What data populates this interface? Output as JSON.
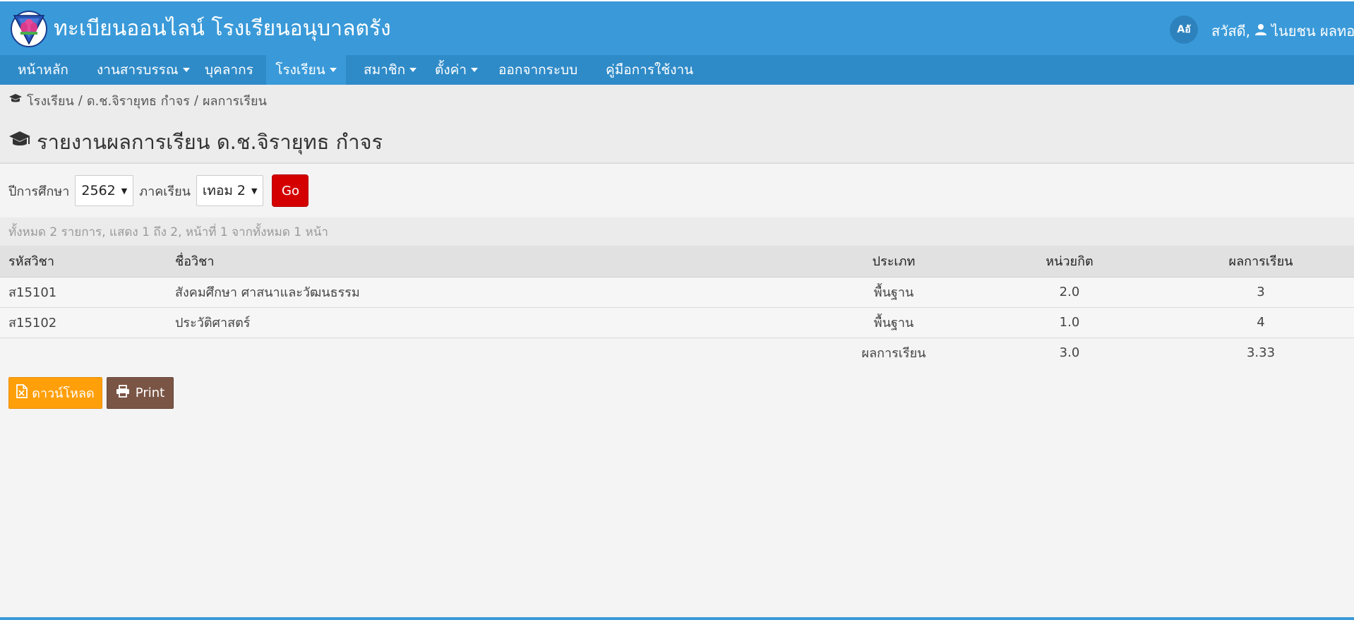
{
  "header": {
    "brand_title": "ทะเบียนออนไลน์ โรงเรียนอนุบาลตรัง",
    "lang_button": "Aอั",
    "greeting": "สวัสดี,",
    "user_name": "ไนยชน ผลทอง"
  },
  "nav": {
    "items": [
      {
        "label": "หน้าหลัก"
      },
      {
        "label": "งานสารบรรณ"
      },
      {
        "label": "บุคลากร"
      },
      {
        "label": "โรงเรียน"
      },
      {
        "label": "สมาชิก"
      },
      {
        "label": "ตั้งค่า"
      },
      {
        "label": "ออกจากระบบ"
      },
      {
        "label": "คู่มือการใช้งาน"
      }
    ]
  },
  "breadcrumb": {
    "items": [
      "โรงเรียน",
      "ด.ช.จิรายุทธ กำจร",
      "ผลการเรียน"
    ],
    "separator": "/"
  },
  "page": {
    "title": "รายงานผลการเรียน ด.ช.จิรายุทธ กำจร"
  },
  "filters": {
    "year_label": "ปีการศึกษา",
    "year_value": "2562",
    "term_label": "ภาคเรียน",
    "term_value": "เทอม 2",
    "go_label": "Go"
  },
  "summary": "ทั้งหมด 2 รายการ, แสดง 1 ถึง 2, หน้าที่ 1 จากทั้งหมด 1 หน้า",
  "table": {
    "headers": [
      "รหัสวิชา",
      "ชื่อวิชา",
      "ประเภท",
      "หน่วยกิต",
      "ผลการเรียน"
    ],
    "rows": [
      {
        "code": "ส15101",
        "name": "สังคมศึกษา ศาสนาและวัฒนธรรม",
        "type": "พื้นฐาน",
        "credit": "2.0",
        "grade": "3"
      },
      {
        "code": "ส15102",
        "name": "ประวัติศาสตร์",
        "type": "พื้นฐาน",
        "credit": "1.0",
        "grade": "4"
      }
    ],
    "total": {
      "label": "ผลการเรียน",
      "credit": "3.0",
      "grade": "3.33"
    }
  },
  "actions": {
    "download_label": "ดาวน์โหลด",
    "print_label": "Print"
  },
  "colors": {
    "header_blue": "#3a9ad9",
    "nav_blue": "#2f8bc8",
    "go_red": "#d40000",
    "download_orange": "#ff9f0a",
    "print_brown": "#7a5545"
  },
  "icons": {
    "logo": "school-logo",
    "user": "user-icon",
    "graduation": "graduation-cap-icon",
    "excel": "excel-file-icon",
    "print": "printer-icon"
  }
}
